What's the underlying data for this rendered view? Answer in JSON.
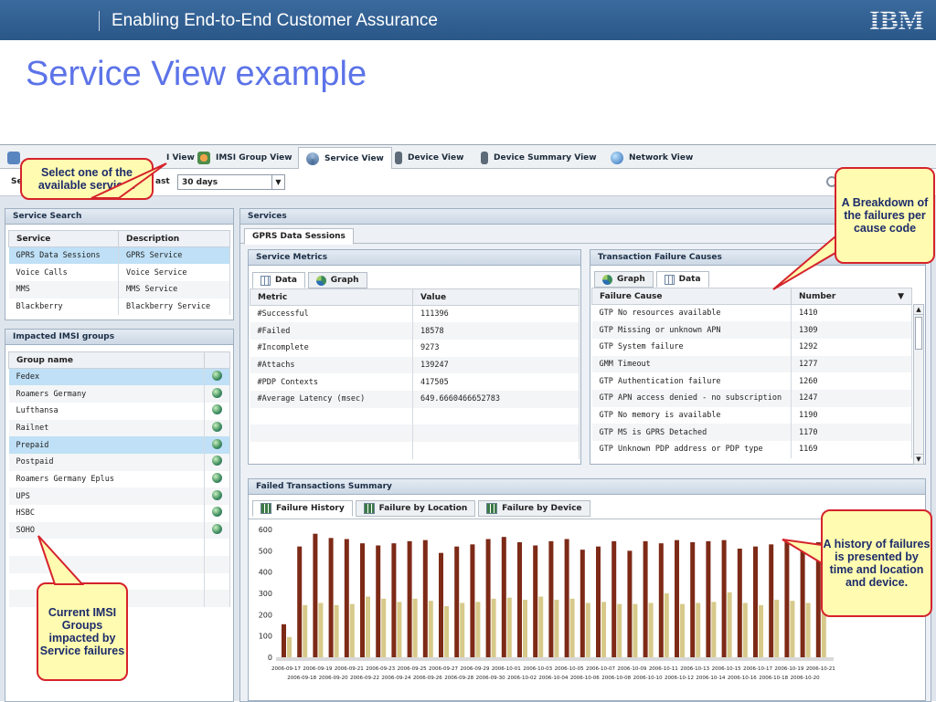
{
  "slide": {
    "header_title": "Enabling End-to-End Customer Assurance",
    "logo": "IBM",
    "title": "Service View example"
  },
  "app": {
    "view_tabs": [
      {
        "label": "I View",
        "icon": "imsi-view-icon"
      },
      {
        "label": "IMSI Group View",
        "icon": "group-icon"
      },
      {
        "label": "Service View",
        "icon": "service-icon",
        "active": true
      },
      {
        "label": "Device View",
        "icon": "device-icon"
      },
      {
        "label": "Device Summary View",
        "icon": "device-summary-icon"
      },
      {
        "label": "Network View",
        "icon": "network-icon"
      }
    ],
    "toolbar": {
      "prefix": "Se",
      "last_label": "ast",
      "period_value": "30 days"
    },
    "service_search": {
      "title": "Service Search",
      "columns": [
        "Service",
        "Description"
      ],
      "rows": [
        [
          "GPRS Data Sessions",
          "GPRS Service"
        ],
        [
          "Voice Calls",
          "Voice Service"
        ],
        [
          "MMS",
          "MMS Service"
        ],
        [
          "Blackberry",
          "Blackberry Service"
        ]
      ]
    },
    "imsi_groups": {
      "title": "Impacted IMSI groups",
      "column": "Group name",
      "rows": [
        "Fedex",
        "Roamers Germany",
        "Lufthansa",
        "Railnet",
        "Prepaid",
        "Postpaid",
        "Roamers Germany Eplus",
        "UPS",
        "HSBC",
        "SOHO"
      ]
    },
    "services": {
      "title": "Services",
      "active_tab": "GPRS Data Sessions",
      "metrics": {
        "title": "Service Metrics",
        "tabs": [
          "Data",
          "Graph"
        ],
        "columns": [
          "Metric",
          "Value"
        ],
        "rows": [
          [
            "#Successful",
            "111396"
          ],
          [
            "#Failed",
            "18578"
          ],
          [
            "#Incomplete",
            "9273"
          ],
          [
            "#Attachs",
            "139247"
          ],
          [
            "#PDP Contexts",
            "417505"
          ],
          [
            "#Average Latency (msec)",
            "649.6660466652783"
          ]
        ]
      },
      "failures": {
        "title": "Transaction Failure Causes",
        "tabs": [
          "Graph",
          "Data"
        ],
        "columns": [
          "Failure Cause",
          "Number"
        ],
        "rows": [
          [
            "GTP No resources available",
            "1410"
          ],
          [
            "GTP Missing or unknown APN",
            "1309"
          ],
          [
            "GTP System failure",
            "1292"
          ],
          [
            "GMM Timeout",
            "1277"
          ],
          [
            "GTP Authentication failure",
            "1260"
          ],
          [
            "GTP APN access denied - no subscription",
            "1247"
          ],
          [
            "GTP No memory is available",
            "1190"
          ],
          [
            "GTP MS is GPRS Detached",
            "1170"
          ],
          [
            "GTP Unknown PDP address or PDP type",
            "1169"
          ]
        ]
      },
      "failed_summary": {
        "title": "Failed Transactions Summary",
        "tabs": [
          "Failure History",
          "Failure by Location",
          "Failure by Device"
        ]
      }
    }
  },
  "callouts": {
    "select_service": "Select one of the available services",
    "breakdown": "A Breakdown of the failures per cause code",
    "history": "A history of failures is presented by time and location and device.",
    "imsi_groups": "Current IMSI Groups impacted by Service failures"
  },
  "chart_data": {
    "type": "bar",
    "categories": [
      "2006-09-17",
      "2006-09-18",
      "2006-09-19",
      "2006-09-20",
      "2006-09-21",
      "2006-09-22",
      "2006-09-23",
      "2006-09-24",
      "2006-09-25",
      "2006-09-26",
      "2006-09-27",
      "2006-09-28",
      "2006-09-29",
      "2006-09-30",
      "2006-10-01",
      "2006-10-02",
      "2006-10-03",
      "2006-10-04",
      "2006-10-05",
      "2006-10-06",
      "2006-10-07",
      "2006-10-08",
      "2006-10-09",
      "2006-10-10",
      "2006-10-11",
      "2006-10-12",
      "2006-10-13",
      "2006-10-14",
      "2006-10-15",
      "2006-10-16",
      "2006-10-17",
      "2006-10-18",
      "2006-10-19",
      "2006-10-20",
      "2006-10-21"
    ],
    "series": [
      {
        "values": [
          155,
          520,
          580,
          560,
          555,
          535,
          525,
          535,
          545,
          550,
          490,
          520,
          530,
          555,
          565,
          540,
          525,
          545,
          555,
          505,
          520,
          545,
          500,
          545,
          535,
          550,
          540,
          545,
          550,
          510,
          520,
          530,
          550,
          525,
          540
        ],
        "color": "#7d2a17"
      },
      {
        "values": [
          95,
          245,
          255,
          245,
          250,
          285,
          275,
          260,
          275,
          265,
          240,
          255,
          260,
          275,
          280,
          270,
          285,
          270,
          275,
          255,
          260,
          250,
          250,
          255,
          300,
          250,
          255,
          260,
          305,
          255,
          245,
          270,
          265,
          255,
          250
        ],
        "color": "#d7c98a"
      }
    ],
    "ylim": [
      0,
      600
    ],
    "yticks": [
      0,
      100,
      200,
      300,
      400,
      500,
      600
    ],
    "grid": false
  }
}
